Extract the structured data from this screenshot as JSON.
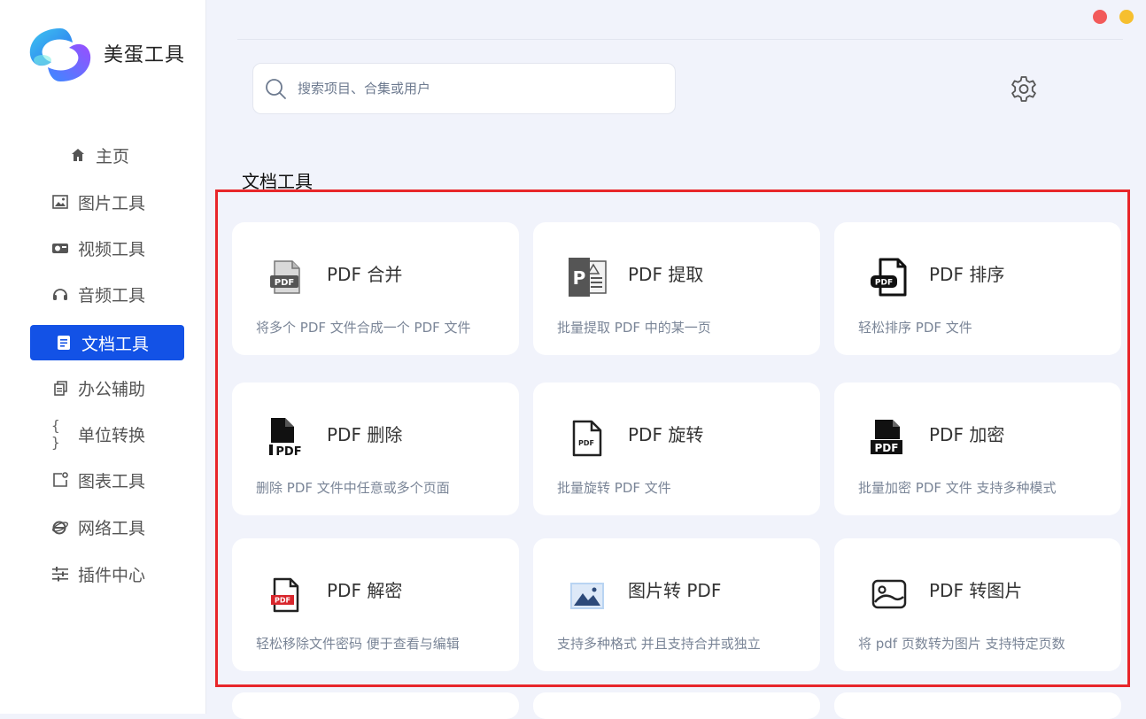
{
  "app": {
    "name": "美蛋工具"
  },
  "sidebar": {
    "items": [
      {
        "label": "主页",
        "icon": "home-icon",
        "active": false
      },
      {
        "label": "图片工具",
        "icon": "image-icon",
        "active": false
      },
      {
        "label": "视频工具",
        "icon": "video-icon",
        "active": false
      },
      {
        "label": "音频工具",
        "icon": "headphones-icon",
        "active": false
      },
      {
        "label": "文档工具",
        "icon": "document-icon",
        "active": true
      },
      {
        "label": "办公辅助",
        "icon": "copy-icon",
        "active": false
      },
      {
        "label": "单位转换",
        "icon": "braces-icon",
        "active": false
      },
      {
        "label": "图表工具",
        "icon": "chart-icon",
        "active": false
      },
      {
        "label": "网络工具",
        "icon": "browser-icon",
        "active": false
      },
      {
        "label": "插件中心",
        "icon": "sliders-icon",
        "active": false
      }
    ]
  },
  "search": {
    "placeholder": "搜索项目、合集或用户"
  },
  "section": {
    "title": "文档工具"
  },
  "cards": [
    {
      "title": "PDF 合并",
      "desc": "将多个 PDF 文件合成一个 PDF 文件",
      "icon": "pdf-merge-icon"
    },
    {
      "title": "PDF 提取",
      "desc": "批量提取 PDF 中的某一页",
      "icon": "pdf-extract-icon"
    },
    {
      "title": "PDF 排序",
      "desc": "轻松排序 PDF 文件",
      "icon": "pdf-sort-icon"
    },
    {
      "title": "PDF 删除",
      "desc": "删除 PDF 文件中任意或多个页面",
      "icon": "pdf-delete-icon"
    },
    {
      "title": "PDF 旋转",
      "desc": "批量旋转 PDF 文件",
      "icon": "pdf-rotate-icon"
    },
    {
      "title": "PDF 加密",
      "desc": "批量加密 PDF 文件 支持多种模式",
      "icon": "pdf-encrypt-icon"
    },
    {
      "title": "PDF 解密",
      "desc": "轻松移除文件密码 便于查看与编辑",
      "icon": "pdf-decrypt-icon"
    },
    {
      "title": "图片转 PDF",
      "desc": "支持多种格式 并且支持合并或独立",
      "icon": "image-to-pdf-icon"
    },
    {
      "title": "PDF 转图片",
      "desc": "将 pdf 页数转为图片 支持特定页数",
      "icon": "pdf-to-image-icon"
    }
  ],
  "icons": {
    "pdf_badge": "PDF",
    "extract_letter": "P"
  },
  "colors": {
    "accent": "#1352e6",
    "close": "#f25a5a",
    "minimize": "#f6bf2f",
    "highlight": "#e8262a",
    "pdf_red": "#d8262c"
  }
}
